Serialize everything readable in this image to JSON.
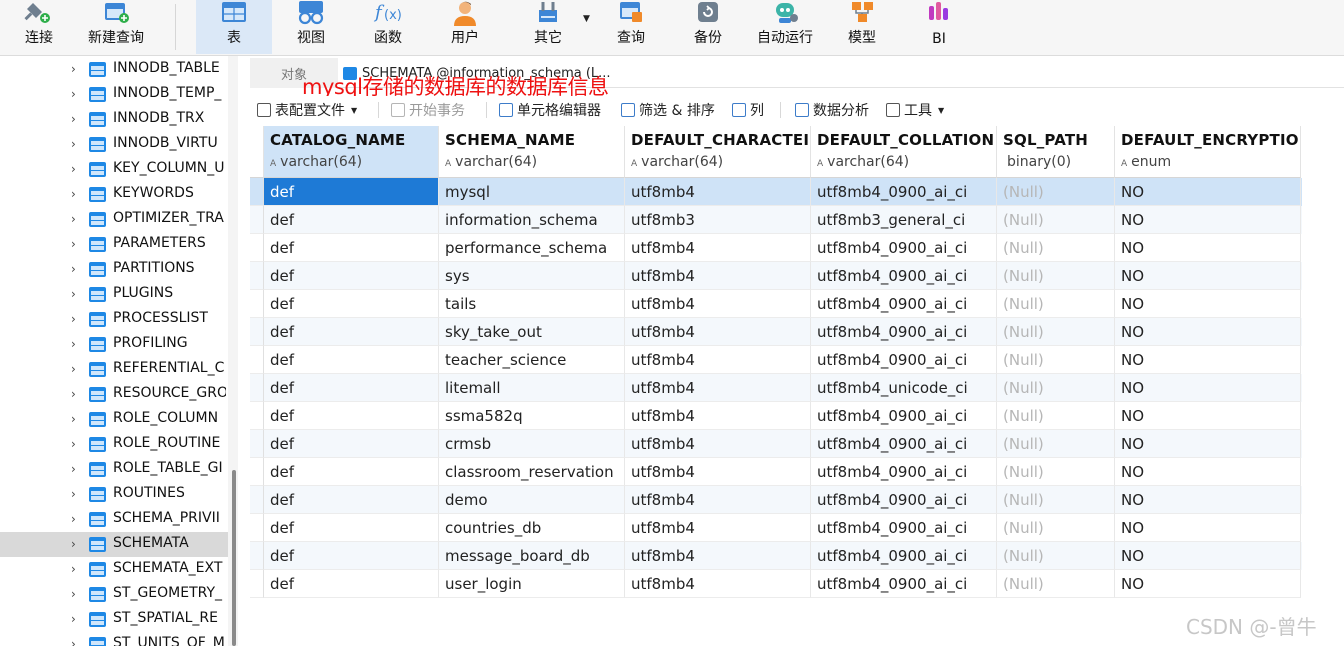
{
  "toolbar": {
    "buttons": [
      {
        "label": "连接",
        "icon": "connect-icon"
      },
      {
        "label": "新建查询",
        "icon": "new-query-icon"
      },
      {
        "label": "表",
        "icon": "table-icon"
      },
      {
        "label": "视图",
        "icon": "view-icon"
      },
      {
        "label": "函数",
        "icon": "function-icon"
      },
      {
        "label": "用户",
        "icon": "user-icon"
      },
      {
        "label": "其它",
        "icon": "other-icon"
      },
      {
        "label": "查询",
        "icon": "query-icon"
      },
      {
        "label": "备份",
        "icon": "backup-icon"
      },
      {
        "label": "自动运行",
        "icon": "automation-icon"
      },
      {
        "label": "模型",
        "icon": "model-icon"
      },
      {
        "label": "BI",
        "icon": "bi-icon"
      }
    ],
    "active": "表"
  },
  "tree": {
    "items": [
      "INNODB_TABLE",
      "INNODB_TEMP_",
      "INNODB_TRX",
      "INNODB_VIRTU",
      "KEY_COLUMN_U",
      "KEYWORDS",
      "OPTIMIZER_TRA",
      "PARAMETERS",
      "PARTITIONS",
      "PLUGINS",
      "PROCESSLIST",
      "PROFILING",
      "REFERENTIAL_C",
      "RESOURCE_GRO",
      "ROLE_COLUMN",
      "ROLE_ROUTINE",
      "ROLE_TABLE_GI",
      "ROUTINES",
      "SCHEMA_PRIVII",
      "SCHEMATA",
      "SCHEMATA_EXT",
      "ST_GEOMETRY_",
      "ST_SPATIAL_RE",
      "ST_UNITS_OF_M"
    ],
    "selected": "SCHEMATA"
  },
  "tabs": {
    "objects": "对象",
    "file": "SCHEMATA @information_schema (L..."
  },
  "annotation": "mysql存储的数据库的数据库信息",
  "subtoolbar": {
    "table_config": "表配置文件",
    "begin_transaction": "开始事务",
    "cell_editor": "单元格编辑器",
    "filter_sort": "筛选 & 排序",
    "column": "列",
    "data_analysis": "数据分析",
    "tools": "工具"
  },
  "grid": {
    "columns": [
      {
        "name": "CATALOG_NAME",
        "type": "varchar(64)"
      },
      {
        "name": "SCHEMA_NAME",
        "type": "varchar(64)"
      },
      {
        "name": "DEFAULT_CHARACTEI",
        "type": "varchar(64)"
      },
      {
        "name": "DEFAULT_COLLATION",
        "type": "varchar(64)"
      },
      {
        "name": "SQL_PATH",
        "type": "binary(0)"
      },
      {
        "name": "DEFAULT_ENCRYPTIO",
        "type": "enum"
      }
    ],
    "rows": [
      [
        "def",
        "mysql",
        "utf8mb4",
        "utf8mb4_0900_ai_ci",
        "(Null)",
        "NO"
      ],
      [
        "def",
        "information_schema",
        "utf8mb3",
        "utf8mb3_general_ci",
        "(Null)",
        "NO"
      ],
      [
        "def",
        "performance_schema",
        "utf8mb4",
        "utf8mb4_0900_ai_ci",
        "(Null)",
        "NO"
      ],
      [
        "def",
        "sys",
        "utf8mb4",
        "utf8mb4_0900_ai_ci",
        "(Null)",
        "NO"
      ],
      [
        "def",
        "tails",
        "utf8mb4",
        "utf8mb4_0900_ai_ci",
        "(Null)",
        "NO"
      ],
      [
        "def",
        "sky_take_out",
        "utf8mb4",
        "utf8mb4_0900_ai_ci",
        "(Null)",
        "NO"
      ],
      [
        "def",
        "teacher_science",
        "utf8mb4",
        "utf8mb4_0900_ai_ci",
        "(Null)",
        "NO"
      ],
      [
        "def",
        "litemall",
        "utf8mb4",
        "utf8mb4_unicode_ci",
        "(Null)",
        "NO"
      ],
      [
        "def",
        "ssma582q",
        "utf8mb4",
        "utf8mb4_0900_ai_ci",
        "(Null)",
        "NO"
      ],
      [
        "def",
        "crmsb",
        "utf8mb4",
        "utf8mb4_0900_ai_ci",
        "(Null)",
        "NO"
      ],
      [
        "def",
        "classroom_reservation",
        "utf8mb4",
        "utf8mb4_0900_ai_ci",
        "(Null)",
        "NO"
      ],
      [
        "def",
        "demo",
        "utf8mb4",
        "utf8mb4_0900_ai_ci",
        "(Null)",
        "NO"
      ],
      [
        "def",
        "countries_db",
        "utf8mb4",
        "utf8mb4_0900_ai_ci",
        "(Null)",
        "NO"
      ],
      [
        "def",
        "message_board_db",
        "utf8mb4",
        "utf8mb4_0900_ai_ci",
        "(Null)",
        "NO"
      ],
      [
        "def",
        "user_login",
        "utf8mb4",
        "utf8mb4_0900_ai_ci",
        "(Null)",
        "NO"
      ]
    ]
  },
  "watermark": "CSDN @-曾牛",
  "colors": {
    "accent": "#1e7ad6",
    "selection": "#cfe3f7",
    "annotation": "#ee1111",
    "null_text": "#b6b6b6"
  }
}
